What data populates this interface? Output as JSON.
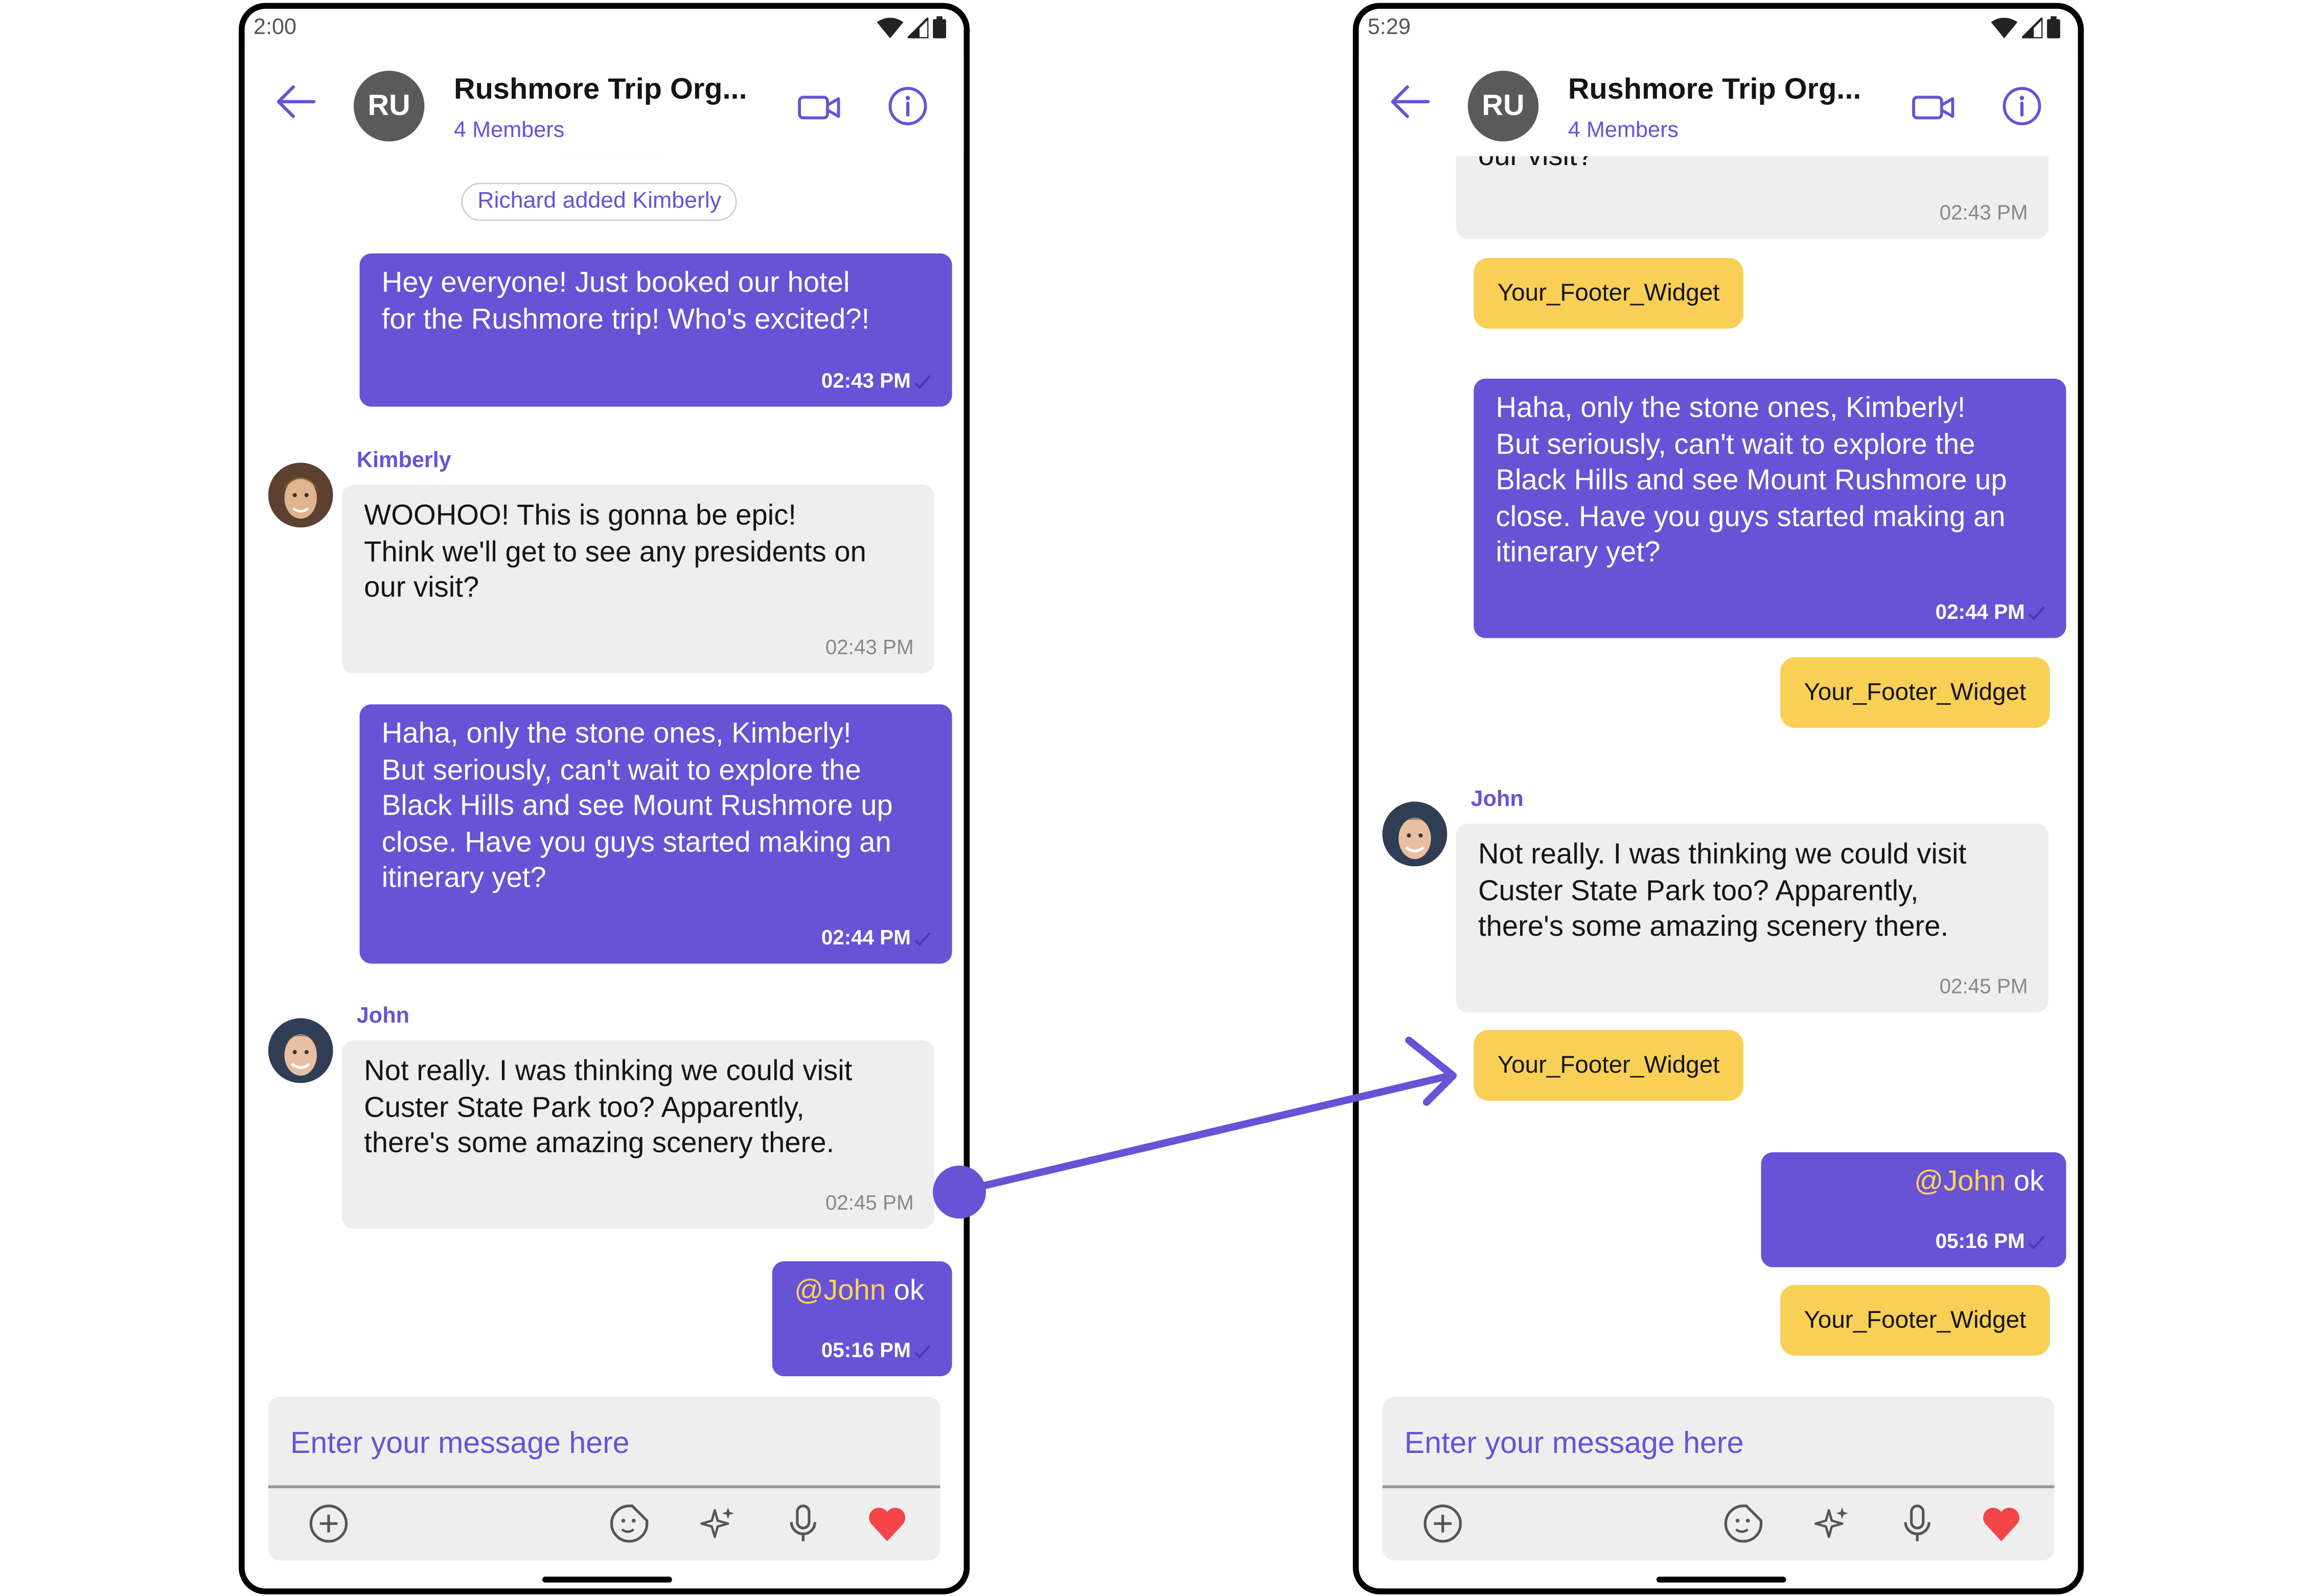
{
  "colors": {
    "accent": "#6852d6",
    "incoming_bubble": "#eeeeee",
    "footer_widget": "#f9cf56",
    "mention": "#ffd35a",
    "heart": "#f44649",
    "arrow": "#6852d6"
  },
  "left": {
    "status_time": "2:00",
    "header": {
      "avatar_initials": "RU",
      "title": "Rushmore Trip Org...",
      "subtitle": "4 Members"
    },
    "system_message": "Richard added Kimberly",
    "messages": [
      {
        "text": "Hey everyone!  Just booked our hotel\nfor the Rushmore trip!  Who's excited?!",
        "time": "02:43 PM"
      },
      {
        "sender": "Kimberly",
        "text": "WOOHOO!  This is gonna be epic!\nThink we'll get to see any presidents on\nour visit?",
        "time": "02:43 PM"
      },
      {
        "text": " Haha, only the stone ones, Kimberly!\nBut seriously, can't wait to explore the\nBlack Hills and see Mount Rushmore up\nclose.  Have you guys started making an\nitinerary yet?",
        "time": "02:44 PM"
      },
      {
        "sender": "John",
        "text": "Not really.  I was thinking we could visit\nCuster State Park too?  Apparently,\nthere's some amazing scenery there.",
        "time": "02:45 PM"
      },
      {
        "mention": "@John",
        "text": " ok",
        "time": "05:16 PM"
      }
    ],
    "composer": {
      "placeholder": "Enter your message here"
    }
  },
  "right": {
    "status_time": "5:29",
    "header": {
      "avatar_initials": "RU",
      "title": "Rushmore Trip Org...",
      "subtitle": "4 Members"
    },
    "partial_text": "our visit?",
    "messages": [
      {
        "time": "02:43 PM"
      },
      {
        "text": " Haha, only the stone ones, Kimberly!\nBut seriously, can't wait to explore the\nBlack Hills and see Mount Rushmore up\nclose.  Have you guys started making an\nitinerary yet?",
        "time": "02:44 PM"
      },
      {
        "sender": "John",
        "text": "Not really.  I was thinking we could visit\nCuster State Park too?  Apparently,\nthere's some amazing scenery there.",
        "time": "02:45 PM"
      },
      {
        "mention": "@John",
        "text": " ok",
        "time": "05:16 PM"
      }
    ],
    "footer_widget": "Your_Footer_Widget",
    "composer": {
      "placeholder": "Enter your message here"
    }
  },
  "icons": [
    "back-arrow-icon",
    "video-call-icon",
    "info-icon",
    "add-icon",
    "sticker-icon",
    "ai-sparkle-icon",
    "microphone-icon",
    "heart-icon",
    "wifi-icon",
    "signal-icon",
    "battery-icon",
    "read-tick-icon"
  ]
}
